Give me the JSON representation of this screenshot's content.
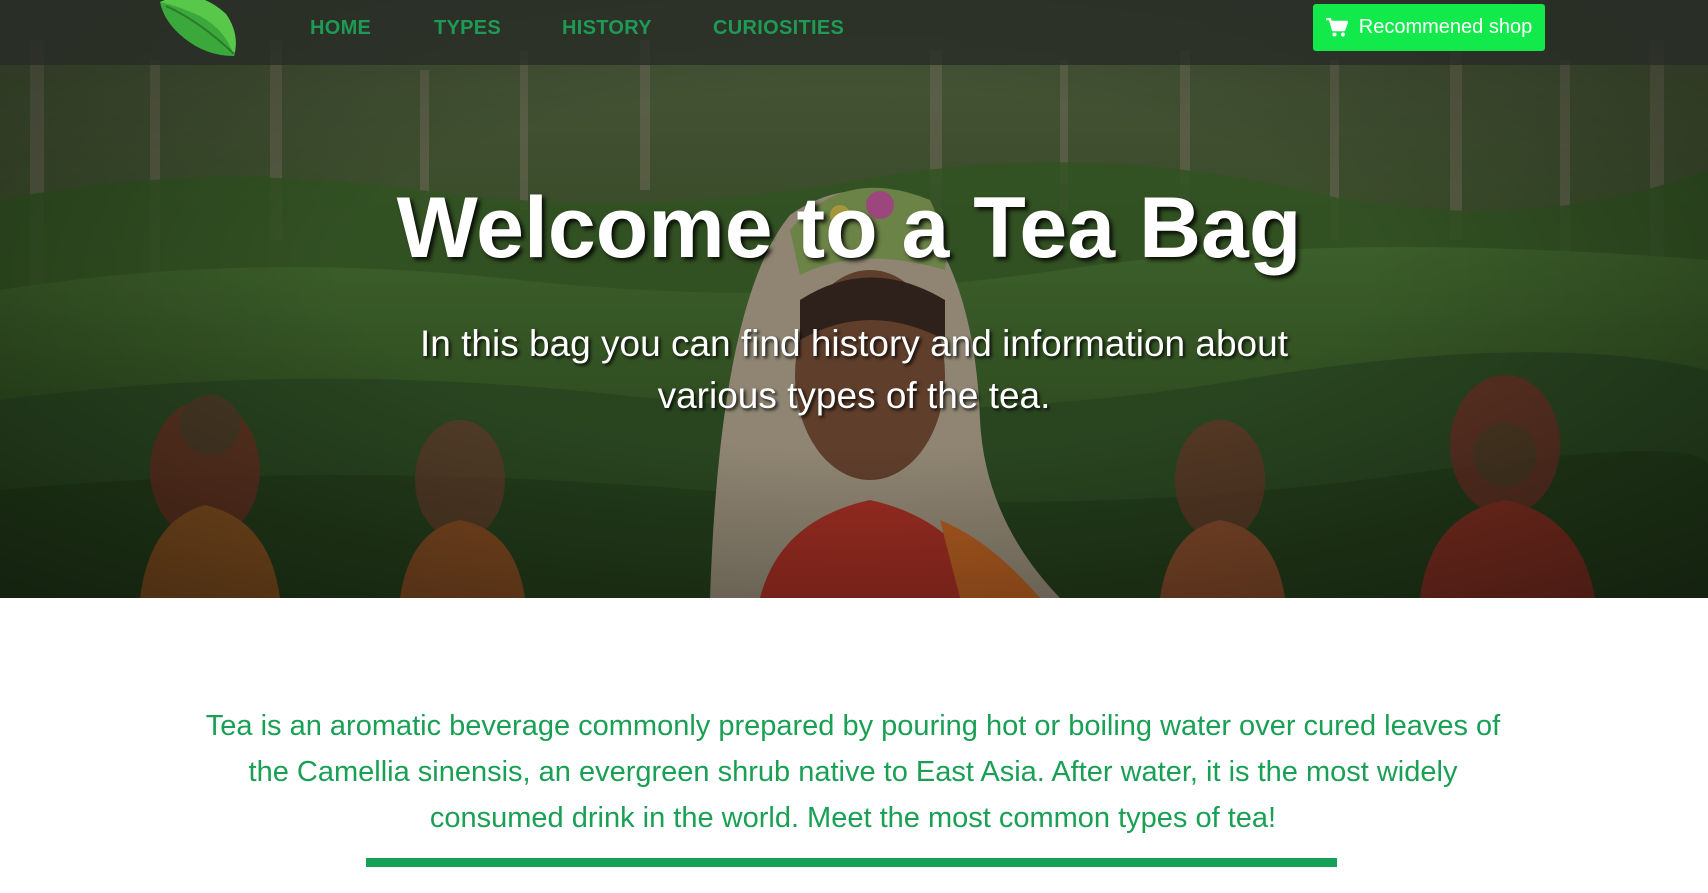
{
  "nav": {
    "logo_icon": "tea-leaf-icon",
    "items": [
      {
        "label": "HOME"
      },
      {
        "label": "TYPES"
      },
      {
        "label": "HISTORY"
      },
      {
        "label": "CURIOSITIES"
      }
    ],
    "shop_button": {
      "label": "Recommened shop",
      "icon": "shopping-cart-icon"
    }
  },
  "hero": {
    "title": "Welcome to a Tea Bag",
    "subtitle": "In this bag you can find history and information about various types of the tea."
  },
  "intro": {
    "text": "Tea is an aromatic beverage commonly prepared by pouring hot or boiling water over cured leaves of the Camellia sinensis, an evergreen shrub native to East Asia. After water, it is the most widely consumed drink in the world. Meet the most common types of tea!"
  },
  "colors": {
    "accent_green": "#1aa055",
    "shop_button": "#12ea4c",
    "nav_background": "#2a2e27"
  }
}
